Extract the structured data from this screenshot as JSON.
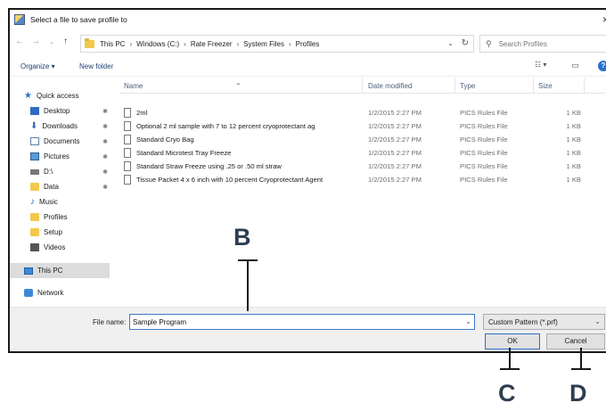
{
  "window": {
    "title": "Select a file to save profile to",
    "close_glyph": "×",
    "app_icon": "app-icon"
  },
  "address": {
    "crumbs": [
      "This PC",
      "Windows (C:)",
      "Rate Freezer",
      "System Files",
      "Profiles"
    ],
    "separator": "›",
    "search_placeholder": "Search Profiles"
  },
  "toolbar": {
    "organize_label": "Organize ▾",
    "new_folder_label": "New folder"
  },
  "sidebar": {
    "items": [
      {
        "label": "Quick access",
        "icon": "star-icon",
        "pinned": false
      },
      {
        "label": "Desktop",
        "icon": "desktop-icon",
        "pinned": true
      },
      {
        "label": "Downloads",
        "icon": "download-icon",
        "pinned": true
      },
      {
        "label": "Documents",
        "icon": "documents-icon",
        "pinned": true
      },
      {
        "label": "Pictures",
        "icon": "pictures-icon",
        "pinned": true
      },
      {
        "label": "D:\\",
        "icon": "drive-icon",
        "pinned": true
      },
      {
        "label": "Data",
        "icon": "folder-icon",
        "pinned": true
      },
      {
        "label": "Music",
        "icon": "music-icon",
        "pinned": false
      },
      {
        "label": "Profiles",
        "icon": "folder-icon",
        "pinned": false
      },
      {
        "label": "Setup",
        "icon": "folder-icon",
        "pinned": false
      },
      {
        "label": "Videos",
        "icon": "videos-icon",
        "pinned": false
      },
      {
        "label": "This PC",
        "icon": "computer-icon",
        "pinned": false,
        "selected": true
      },
      {
        "label": "Network",
        "icon": "network-icon",
        "pinned": false
      }
    ]
  },
  "files": {
    "columns": {
      "name": "Name",
      "date": "Date modified",
      "type": "Type",
      "size": "Size"
    },
    "rows": [
      {
        "name": "2ml",
        "date": "1/2/2015 2:27 PM",
        "type": "PICS Rules File",
        "size": "1 KB"
      },
      {
        "name": "Optional 2 ml sample with 7 to 12 percent cryoprotectant ag",
        "date": "1/2/2015 2:27 PM",
        "type": "PICS Rules File",
        "size": "1 KB"
      },
      {
        "name": "Standard Cryo Bag",
        "date": "1/2/2015 2:27 PM",
        "type": "PICS Rules File",
        "size": "1 KB"
      },
      {
        "name": "Standard Microtest Tray Freeze",
        "date": "1/2/2015 2:27 PM",
        "type": "PICS Rules File",
        "size": "1 KB"
      },
      {
        "name": "Standard Straw Freeze using .25 or .50 ml straw",
        "date": "1/2/2015 2:27 PM",
        "type": "PICS Rules File",
        "size": "1 KB"
      },
      {
        "name": "Tissue Packet 4 x 6 inch with 10 percent Cryoprotectant Agent",
        "date": "1/2/2015 2:27 PM",
        "type": "PICS Rules File",
        "size": "1 KB"
      }
    ]
  },
  "footer": {
    "filename_label": "File name:",
    "filename_value": "Sample Program",
    "filetype_value": "Custom Pattern (*.prf)",
    "ok_label": "OK",
    "cancel_label": "Cancel"
  },
  "callouts": {
    "b": "B",
    "c": "C",
    "d": "D"
  },
  "colors": {
    "accent": "#2a6fd1",
    "callout_text": "#2f3d50",
    "folder": "#f2c94c"
  }
}
